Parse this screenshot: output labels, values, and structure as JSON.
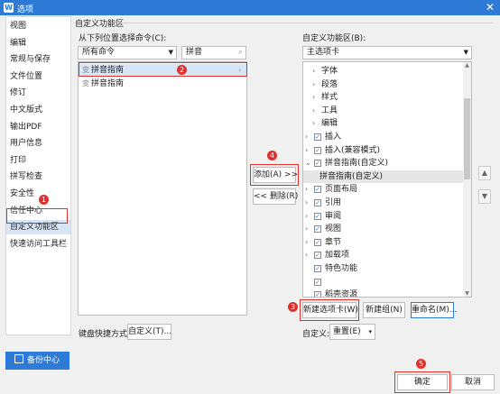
{
  "window": {
    "title": "选项",
    "close_label": "✕"
  },
  "nav": {
    "items": [
      "视图",
      "编辑",
      "常规与保存",
      "文件位置",
      "修订",
      "中文版式",
      "输出PDF",
      "用户信息",
      "打印",
      "拼写检查",
      "安全性",
      "信任中心",
      "自定义功能区",
      "快速访问工具栏"
    ],
    "active_index": 12
  },
  "backup": {
    "label": "备份中心"
  },
  "group": {
    "title": "自定义功能区"
  },
  "left": {
    "label": "从下列位置选择命令(C):",
    "source_select": "所有命令",
    "search_value": "拼音",
    "items": [
      "拼音指南",
      "拼音指南"
    ]
  },
  "middle": {
    "add_button": "添加(A) >>",
    "remove_button": "<< 删除(R)"
  },
  "right": {
    "label": "自定义功能区(B):",
    "select": "主选项卡",
    "tree": [
      {
        "text": "字体",
        "checkbox": false,
        "indent": 1,
        "expander": "›"
      },
      {
        "text": "段落",
        "checkbox": false,
        "indent": 1,
        "expander": "›"
      },
      {
        "text": "样式",
        "checkbox": false,
        "indent": 1,
        "expander": "›"
      },
      {
        "text": "工具",
        "checkbox": false,
        "indent": 1,
        "expander": "›"
      },
      {
        "text": "编辑",
        "checkbox": false,
        "indent": 1,
        "expander": "›"
      },
      {
        "text": "插入",
        "checkbox": true,
        "indent": 0,
        "expander": "›"
      },
      {
        "text": "插入(兼容模式)",
        "checkbox": true,
        "indent": 0,
        "expander": "›"
      },
      {
        "text": "拼音指南(自定义)",
        "checkbox": true,
        "indent": 0,
        "expander": "⌄"
      },
      {
        "text": "拼音指南(自定义)",
        "checkbox": false,
        "indent": 1,
        "expander": ""
      },
      {
        "text": "页面布局",
        "checkbox": true,
        "indent": 0,
        "expander": "›"
      },
      {
        "text": "引用",
        "checkbox": true,
        "indent": 0,
        "expander": "›"
      },
      {
        "text": "审阅",
        "checkbox": true,
        "indent": 0,
        "expander": "›"
      },
      {
        "text": "视图",
        "checkbox": true,
        "indent": 0,
        "expander": "›"
      },
      {
        "text": "章节",
        "checkbox": true,
        "indent": 0,
        "expander": "›"
      },
      {
        "text": "加载项",
        "checkbox": true,
        "indent": 0,
        "expander": "›"
      },
      {
        "text": "特色功能",
        "checkbox": true,
        "indent": 0,
        "expander": ""
      },
      {
        "text": "",
        "checkbox": true,
        "indent": 0,
        "expander": ""
      },
      {
        "text": "稻壳资源",
        "checkbox": true,
        "indent": 0,
        "expander": ""
      }
    ],
    "up_label": "▲",
    "down_label": "▼",
    "new_tab_button": "新建选项卡(W)",
    "new_group_button": "新建组(N)",
    "rename_button": "重命名(M)..."
  },
  "keyboard": {
    "label": "键盘快捷方式:",
    "button": "自定义(T)..."
  },
  "customize": {
    "label": "自定义:",
    "reset_button": "重置(E)",
    "reset_arrow": "▾"
  },
  "footer": {
    "ok_button": "确定",
    "cancel_button": "取消"
  },
  "annotations": [
    "1",
    "2",
    "3",
    "4",
    "5"
  ],
  "colors": {
    "accent": "#2d7bd6",
    "annotation": "#e0302c",
    "selection": "#d7e6f7"
  }
}
